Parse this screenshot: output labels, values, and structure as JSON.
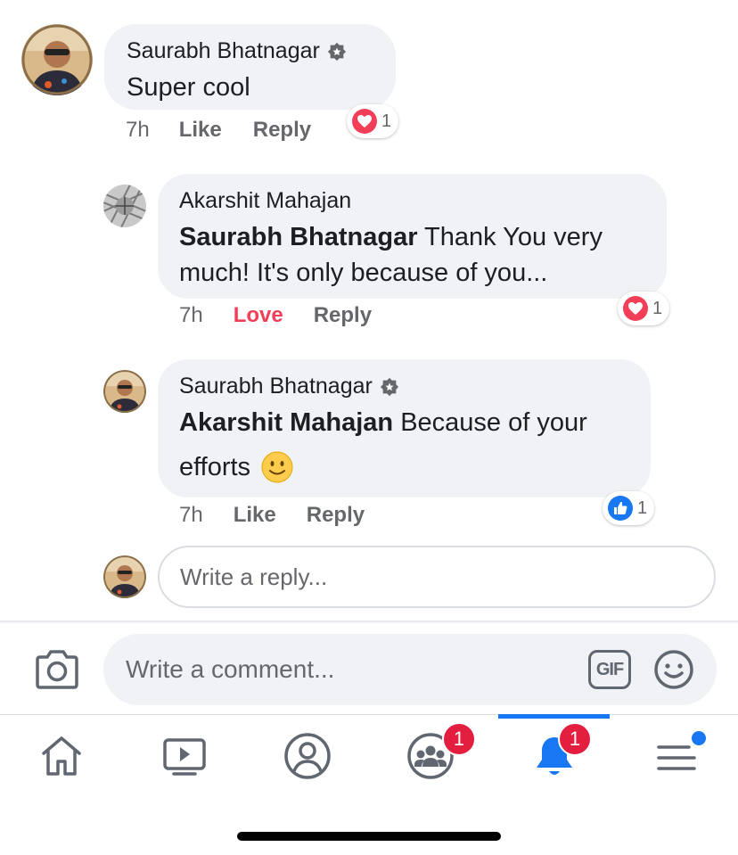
{
  "comments": [
    {
      "author": "Saurabh Bhatnagar",
      "verified": true,
      "text": "Super cool",
      "time": "7h",
      "like_label": "Like",
      "reply_label": "Reply",
      "reaction_icon": "love-icon",
      "reaction_count": "1"
    },
    {
      "author": "Akarshit Mahajan",
      "verified": false,
      "mention": "Saurabh Bhatnagar",
      "text_line1": " Thank You very",
      "text_line2": "much! It's only because of you...",
      "time": "7h",
      "like_label": "Love",
      "reply_label": "Reply",
      "reaction_icon": "love-icon",
      "reaction_count": "1"
    },
    {
      "author": "Saurabh Bhatnagar",
      "verified": true,
      "mention": "Akarshit Mahajan",
      "text_line1": " Because of your",
      "text_line2": "efforts",
      "emoji": "🙂",
      "time": "7h",
      "like_label": "Like",
      "reply_label": "Reply",
      "reaction_icon": "like-icon",
      "reaction_count": "1"
    }
  ],
  "reply_input": {
    "placeholder": "Write a reply..."
  },
  "composer": {
    "placeholder": "Write a comment...",
    "gif_label": "GIF"
  },
  "tabbar": {
    "active": "notifications",
    "groups_badge": "1",
    "notifications_badge": "1"
  },
  "colors": {
    "accent": "#1877f2",
    "love": "#f33e58",
    "badge": "#e41e3f"
  }
}
